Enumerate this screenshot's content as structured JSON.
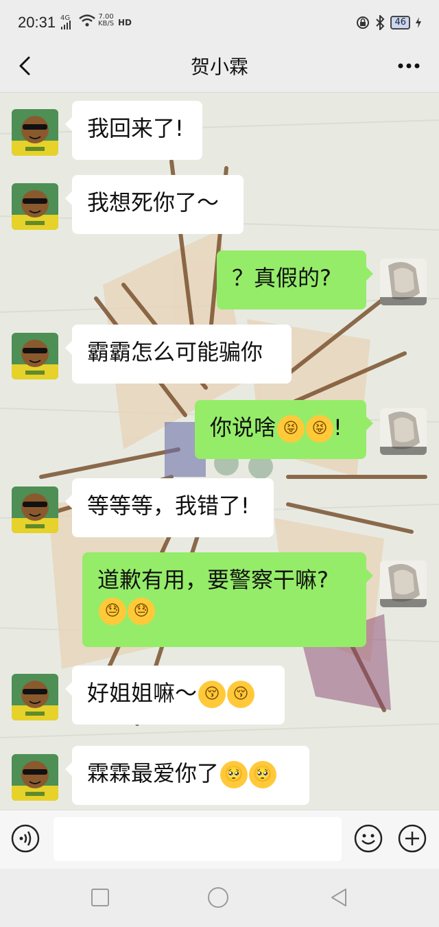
{
  "status": {
    "time": "20:31",
    "signal": "4G",
    "net_speed_value": "7.00",
    "net_speed_unit": "KB/S",
    "hd": "HD",
    "battery": "46"
  },
  "header": {
    "title": "贺小霖"
  },
  "messages": [
    {
      "side": "in",
      "text": "我回来了!",
      "emoji": []
    },
    {
      "side": "in",
      "text": "我想死你了～",
      "emoji": []
    },
    {
      "side": "out",
      "text": "？真假的?",
      "emoji": []
    },
    {
      "side": "in",
      "text": "霸霸怎么可能骗你",
      "emoji": []
    },
    {
      "side": "out",
      "text": "你说啥",
      "emoji": [
        "😝",
        "😝"
      ],
      "suffix": "!"
    },
    {
      "side": "in",
      "text": "等等等，我错了!",
      "emoji": []
    },
    {
      "side": "out",
      "text": "道歉有用，要警察干嘛?",
      "emoji": [
        "😓",
        "😓"
      ]
    },
    {
      "side": "in",
      "text": "好姐姐嘛～",
      "emoji": [
        "😚",
        "😚"
      ]
    },
    {
      "side": "in",
      "text": "霖霖最爱你了",
      "emoji": [
        "🥺",
        "🥺"
      ]
    }
  ],
  "colors": {
    "incoming_bubble": "#ffffff",
    "outgoing_bubble": "#95ec69",
    "background": "#ededed"
  },
  "icons": {
    "back": "chevron-left-icon",
    "more": "more-dots-icon",
    "voice": "voice-icon",
    "emoji": "smile-icon",
    "add": "plus-circle-icon"
  }
}
